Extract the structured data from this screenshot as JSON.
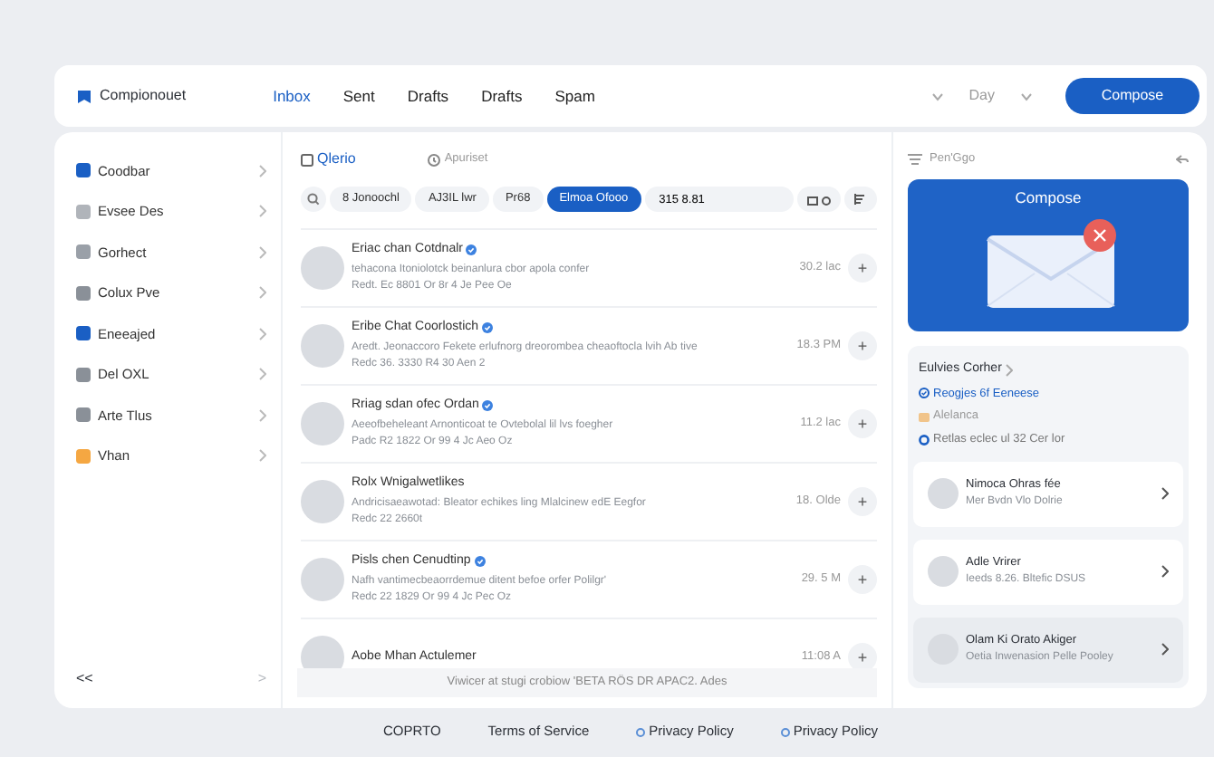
{
  "topbar": {
    "app_name": "Compionouet",
    "tabs": [
      {
        "label": "Inbox",
        "selected": true
      },
      {
        "label": "Sent",
        "selected": false
      },
      {
        "label": "Drafts",
        "selected": false
      },
      {
        "label": "Drafts",
        "selected": false
      },
      {
        "label": "Spam",
        "selected": false
      }
    ],
    "period": "Day",
    "compose": "Compose"
  },
  "sidebar": {
    "items": [
      {
        "label": "Coodbar",
        "color": "#1a5fc4"
      },
      {
        "label": "Evsee Des",
        "color": "#b0b4ba"
      },
      {
        "label": "Gorhect",
        "color": "#9aa0a8"
      },
      {
        "label": "Colux Pve",
        "color": "#8a9098"
      },
      {
        "label": "Eneeajed",
        "color": "#1a5fc4"
      },
      {
        "label": "Del OXL",
        "color": "#8a9098"
      },
      {
        "label": "Arte Tlus",
        "color": "#8a9098"
      },
      {
        "label": "Vhan",
        "color": "#f5a742"
      }
    ],
    "collapse": "<<",
    "expand": ">"
  },
  "list": {
    "select_all_checked": false,
    "select_label": "Qlerio",
    "clock_label": "Apuriset",
    "filters": [
      {
        "label": "8 Jonoochl",
        "selected": false
      },
      {
        "label": "AJ3IL lwr",
        "selected": false
      },
      {
        "label": "Pr68",
        "selected": false
      },
      {
        "label": "Elmoa Ofooo",
        "selected": true
      }
    ],
    "filter_field": "315 8.81",
    "rows": [
      {
        "name": "Eriac chan Cotdnalr",
        "verified": true,
        "preview": "tehacona Itoniolotck beinanlura cbor apola confer",
        "meta": "Redt. Ec 8801 Or 8r 4 Je Pee Oe",
        "time": "30.2 lac",
        "action": "+"
      },
      {
        "name": "Eribe Chat Coorlostich",
        "verified": true,
        "preview": "Aredt. Jeonaccoro Fekete erlufnorg dreorombea cheaoftocla lvih Ab tive",
        "meta": "Redc 36. 3330 R4 30 Aen 2",
        "time": "18.3 PM",
        "action": "+"
      },
      {
        "name": "Rriag sdan ofec Ordan",
        "verified": true,
        "preview": "Aeeofbeheleant Arnonticoat te Ovtebolal lil lvs foegher",
        "meta": "Padc R2 1822 Or 99 4 Jc Aeo Oz",
        "time": "11.2 lac",
        "action": "+"
      },
      {
        "name": "Rolx Wnigalwetlikes",
        "verified": false,
        "preview": "Andricisaeawotad: Bleator echikes ling Mlalcinew edE Eegfor",
        "meta": "Redc 22 2660t",
        "time": "18. Olde",
        "action": "+"
      },
      {
        "name": "Pisls chen Cenudtinp",
        "verified": true,
        "preview": "Nafh vantimecbeaorrdemue ditent befoe orfer Polilgr'",
        "meta": "Redc 22 1829 Or 99 4 Jc Pec Oz",
        "time": "29. 5 M",
        "action": "+"
      },
      {
        "name": "Aobe Mhan Actulemer",
        "verified": false,
        "time": "11:08 A",
        "action": "+"
      }
    ],
    "toast": "Viwicer at stugi crobiow 'BETA RÖS DR APAC2. Ades"
  },
  "panel": {
    "header": "Pen'Ggo",
    "compose_card": "Compose",
    "section_title": "Eulvies Corher",
    "section_items": [
      {
        "kind": "check",
        "label": "Reogjes 6f Eeneese"
      },
      {
        "kind": "tag",
        "label": "Alelanca"
      },
      {
        "kind": "ring",
        "label": "Retlas eclec ul 32 Cer lor"
      }
    ],
    "contacts": [
      {
        "name": "Nimoca Ohras fée",
        "detail": "Mer Bvdn Vlo Dolrie",
        "selected": false
      },
      {
        "name": "Adle Vrirer",
        "detail": "Ieeds 8.26. Bltefic DSUS",
        "selected": false
      },
      {
        "name": "Olam Ki Orato Akiger",
        "detail": "Oetia Inwenasion Pelle Pooley",
        "selected": true
      }
    ]
  },
  "footer": [
    "COPRTO",
    "Terms of Service",
    "Privacy Policy",
    "Privacy Policy"
  ]
}
